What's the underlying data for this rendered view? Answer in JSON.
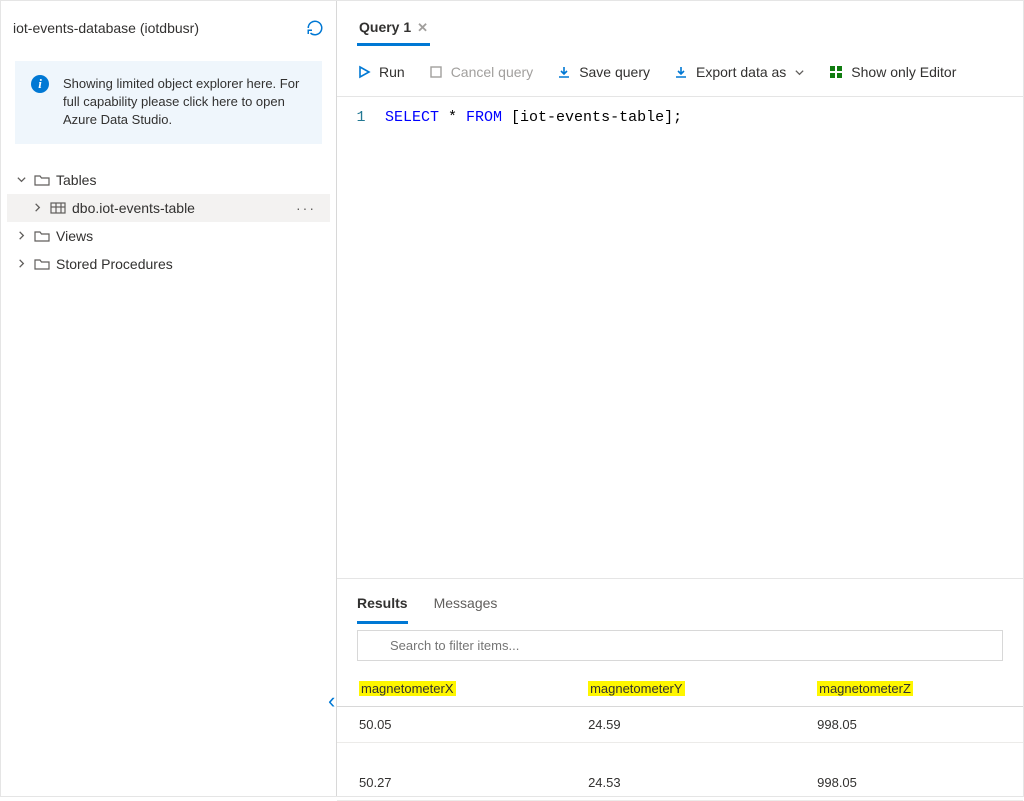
{
  "sidebar": {
    "title": "iot-events-database (iotdbusr)",
    "info_message": "Showing limited object explorer here. For full capability please click here to open Azure Data Studio.",
    "tree": {
      "tables_label": "Tables",
      "table_item_label": "dbo.iot-events-table",
      "views_label": "Views",
      "stored_procedures_label": "Stored Procedures"
    }
  },
  "tabs": {
    "query_tab_label": "Query 1"
  },
  "toolbar": {
    "run_label": "Run",
    "cancel_label": "Cancel query",
    "save_label": "Save query",
    "export_label": "Export data as",
    "show_editor_label": "Show only Editor"
  },
  "editor": {
    "line_number": "1",
    "sql_select": "SELECT",
    "sql_star": " * ",
    "sql_from": "FROM",
    "sql_table": " [iot-events-table];"
  },
  "results": {
    "results_tab": "Results",
    "messages_tab": "Messages",
    "filter_placeholder": "Search to filter items...",
    "columns": [
      "magnetometerX",
      "magnetometerY",
      "magnetometerZ"
    ],
    "rows": [
      [
        "50.05",
        "24.59",
        "998.05"
      ],
      [
        "50.27",
        "24.53",
        "998.05"
      ]
    ]
  }
}
